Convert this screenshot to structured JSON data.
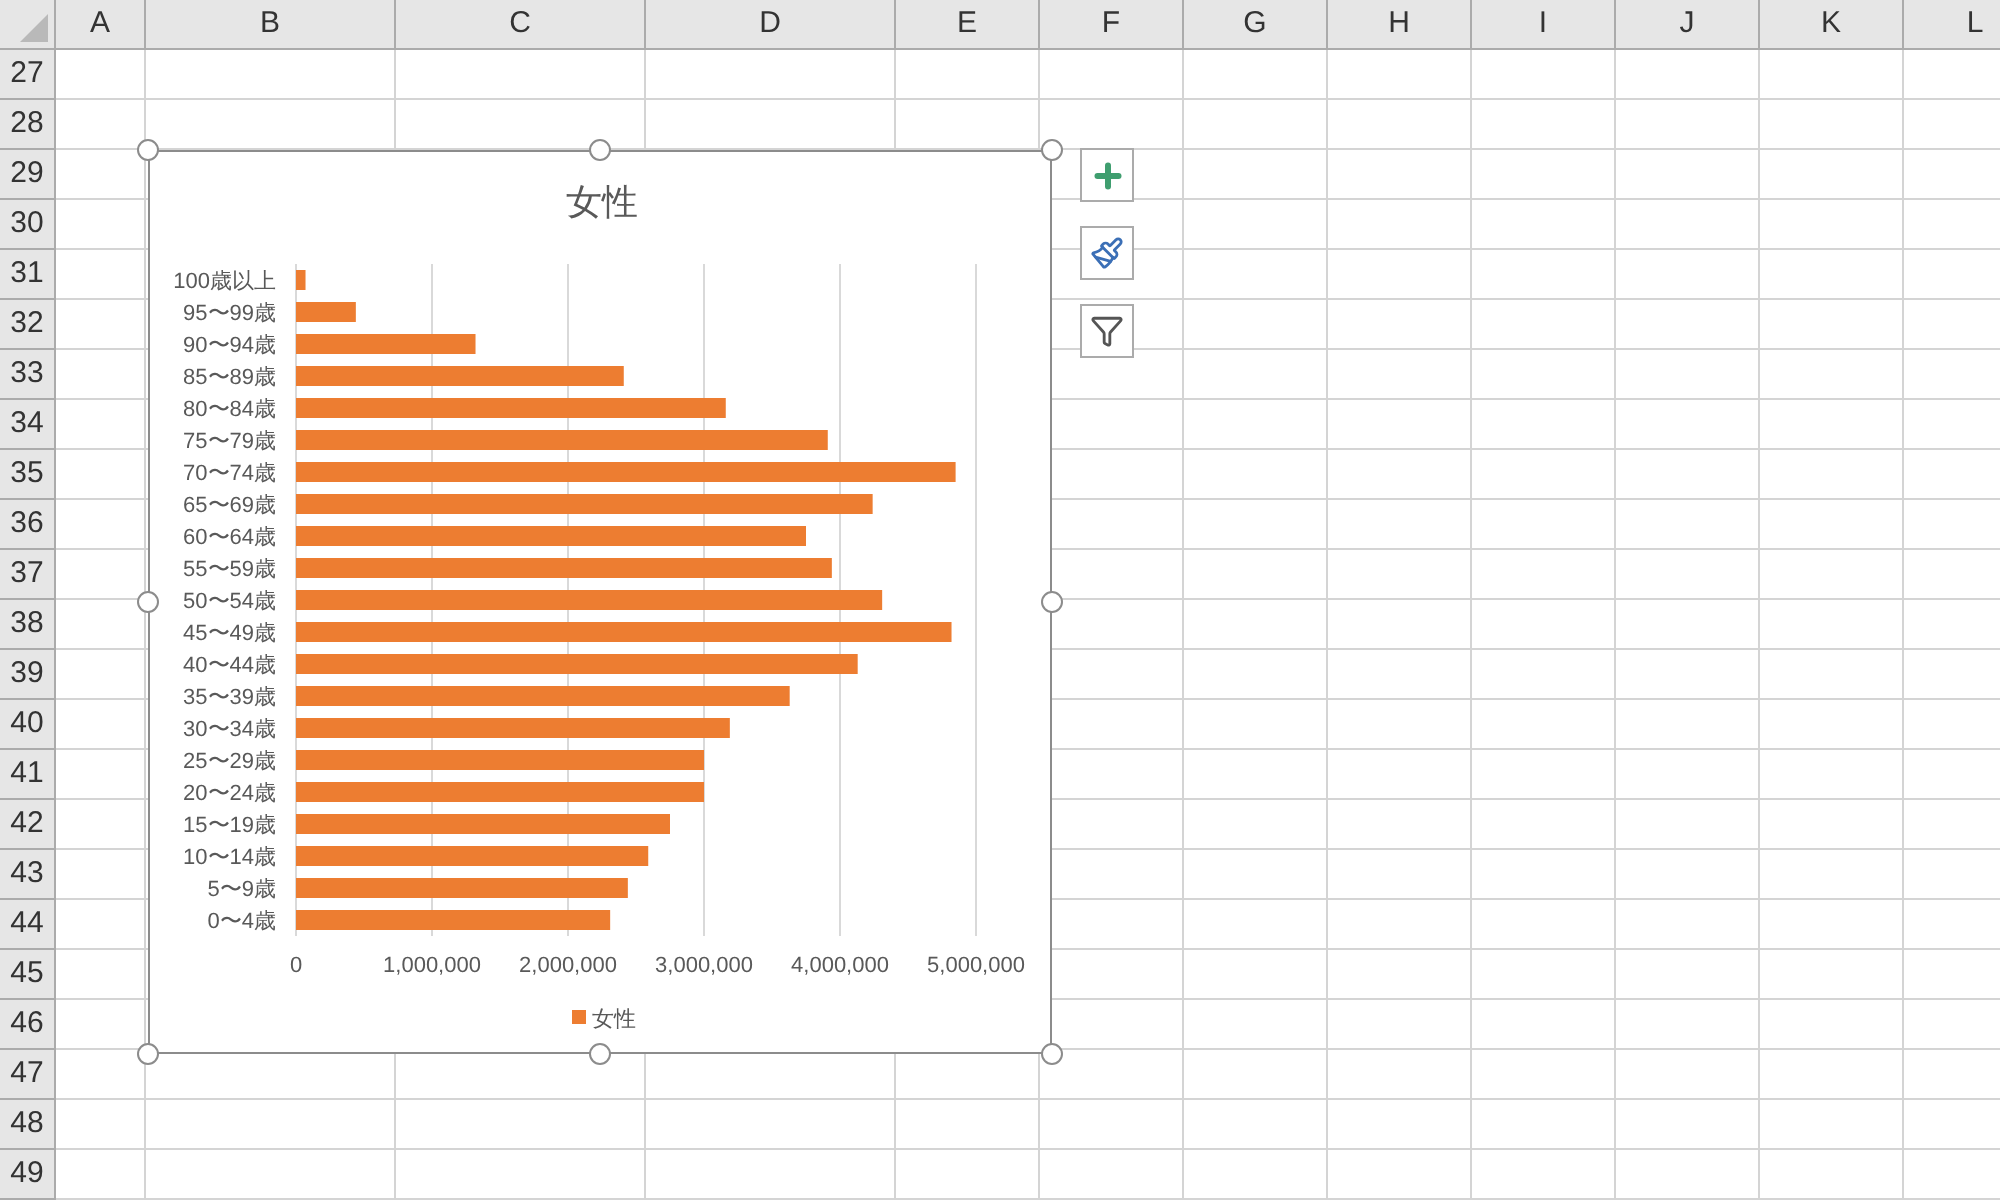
{
  "sheet": {
    "columns": [
      "A",
      "B",
      "C",
      "D",
      "E",
      "F",
      "G",
      "H",
      "I",
      "J",
      "K",
      "L"
    ],
    "rows": [
      "27",
      "28",
      "29",
      "30",
      "31",
      "32",
      "33",
      "34",
      "35",
      "36",
      "37",
      "38",
      "39",
      "40",
      "41",
      "42",
      "43",
      "44",
      "45",
      "46",
      "47",
      "48",
      "49"
    ]
  },
  "chart": {
    "chart_data": {
      "type": "bar",
      "orientation": "horizontal",
      "grid": true,
      "title": "女性",
      "categories": [
        "100歳以上",
        "95〜99歳",
        "90〜94歳",
        "85〜89歳",
        "80〜84歳",
        "75〜79歳",
        "70〜74歳",
        "65〜69歳",
        "60〜64歳",
        "55〜59歳",
        "50〜54歳",
        "45〜49歳",
        "40〜44歳",
        "35〜39歳",
        "30〜34歳",
        "25〜29歳",
        "20〜24歳",
        "15〜19歳",
        "10〜14歳",
        "5〜9歳",
        "0〜4歳"
      ],
      "series": [
        {
          "name": "女性",
          "color": "#ed7d31",
          "values": [
            70000,
            440000,
            1320000,
            2410000,
            3160000,
            3910000,
            4850000,
            4240000,
            3750000,
            3940000,
            4310000,
            4820000,
            4130000,
            3630000,
            3190000,
            3000000,
            3000000,
            2750000,
            2590000,
            2440000,
            2310000
          ]
        }
      ],
      "xlim": [
        0,
        5000000
      ],
      "xticks": [
        {
          "value": 0,
          "label": "0"
        },
        {
          "value": 1000000,
          "label": "1,000,000"
        },
        {
          "value": 2000000,
          "label": "2,000,000"
        },
        {
          "value": 3000000,
          "label": "3,000,000"
        },
        {
          "value": 4000000,
          "label": "4,000,000"
        },
        {
          "value": 5000000,
          "label": "5,000,000"
        }
      ]
    }
  }
}
